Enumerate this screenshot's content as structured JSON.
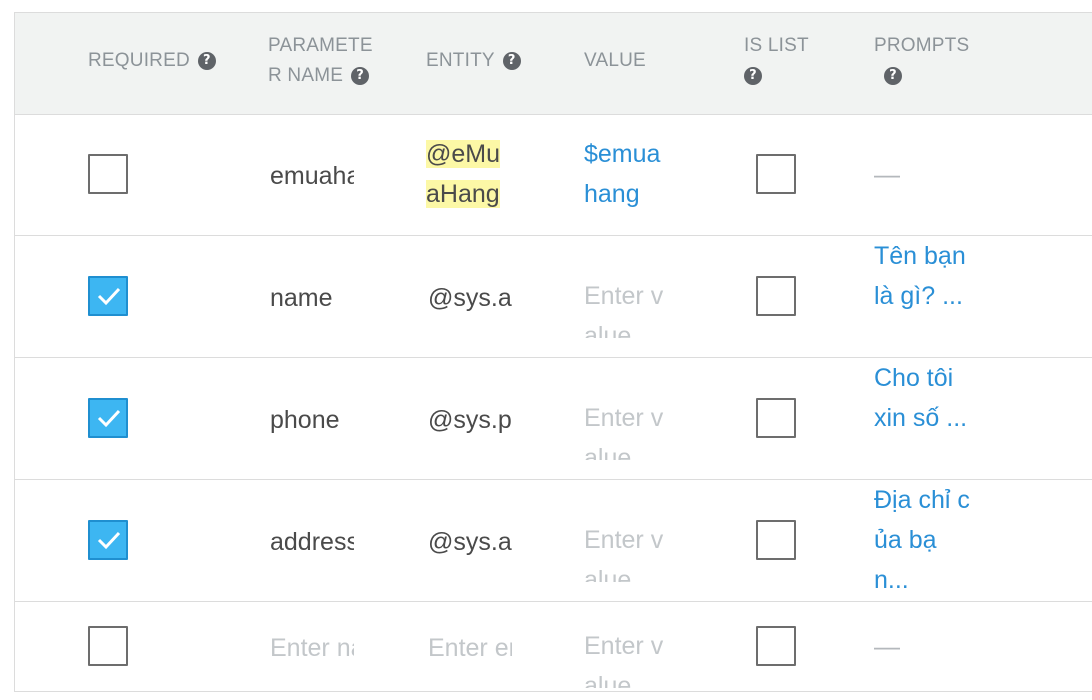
{
  "headers": {
    "required": "REQUIRED",
    "param_line1": "PARAMETE",
    "param_line2": "R NAME",
    "entity": "ENTITY",
    "value": "VALUE",
    "islist_line1": "IS LIST",
    "prompts": "PROMPTS",
    "help_glyph": "?"
  },
  "rows": [
    {
      "required": false,
      "name": "emuahang",
      "entity_line1": "@eMu",
      "entity_line2": "aHang",
      "value_line1": "$emua",
      "value_line2": "hang",
      "is_list": false,
      "prompts": "—"
    },
    {
      "required": true,
      "name": "name",
      "entity": "@sys.any",
      "value_placeholder": "Enter value",
      "is_list": false,
      "prompts": "Tên bạn là gì? ..."
    },
    {
      "required": true,
      "name": "phone",
      "entity": "@sys.phone-number",
      "value_placeholder": "Enter value",
      "is_list": false,
      "prompts": "Cho tôi xin số ..."
    },
    {
      "required": true,
      "name": "address",
      "entity": "@sys.address",
      "value_placeholder": "Enter value",
      "is_list": false,
      "prompts": "Địa chỉ của bạn..."
    },
    {
      "required": false,
      "name_placeholder": "Enter name",
      "entity_placeholder": "Enter entity",
      "value_placeholder": "Enter value",
      "is_list": false,
      "prompts": "—"
    }
  ],
  "colors": {
    "header_bg": "#f1f3f2",
    "checkbox_checked": "#3db6f2",
    "link": "#2a8fd6",
    "highlight": "#fcf8a6"
  }
}
